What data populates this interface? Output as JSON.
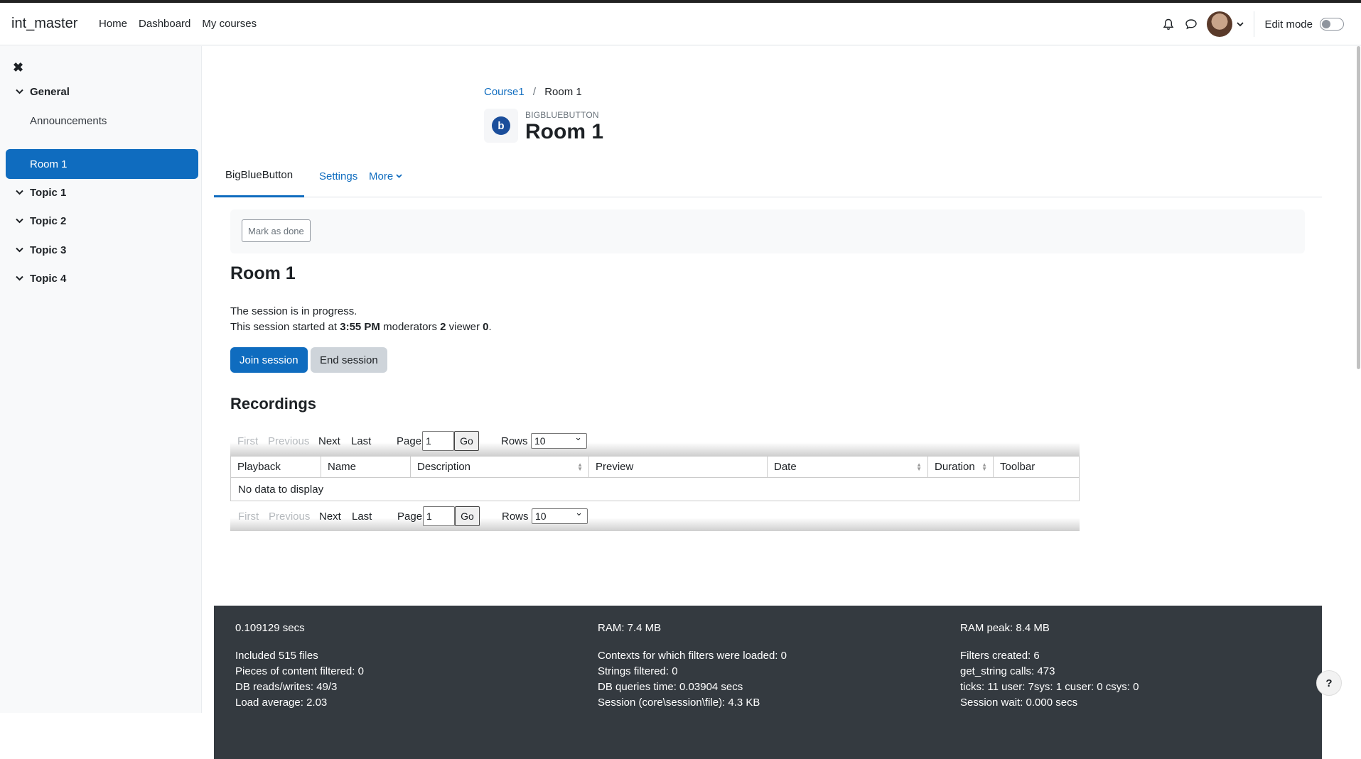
{
  "navbar": {
    "brand": "int_master",
    "links": [
      "Home",
      "Dashboard",
      "My courses"
    ],
    "edit_mode_label": "Edit mode"
  },
  "drawer": {
    "items": [
      {
        "label": "General",
        "type": "section"
      },
      {
        "label": "Announcements",
        "type": "link"
      },
      {
        "label": "Room 1",
        "type": "link",
        "active": true
      },
      {
        "label": "Topic 1",
        "type": "section"
      },
      {
        "label": "Topic 2",
        "type": "section"
      },
      {
        "label": "Topic 3",
        "type": "section"
      },
      {
        "label": "Topic 4",
        "type": "section"
      }
    ]
  },
  "breadcrumb": {
    "course": "Course1",
    "sep": "/",
    "current": "Room 1"
  },
  "activity": {
    "type": "BIGBLUEBUTTON",
    "title": "Room 1",
    "icon_letter": "b"
  },
  "tabs": [
    "BigBlueButton",
    "Settings",
    "More"
  ],
  "completion": {
    "button": "Mark as done"
  },
  "room": {
    "heading": "Room 1",
    "status_line": "The session is in progress.",
    "started_prefix": "This session started at ",
    "started_time": "3:55 PM",
    "moderators_text": " moderators ",
    "moderators_count": "2",
    "viewer_text": " viewer ",
    "viewer_count": "0",
    "end_punct": ".",
    "join_button": "Join session",
    "end_button": "End session"
  },
  "recordings": {
    "heading": "Recordings",
    "pager": {
      "first": "First",
      "previous": "Previous",
      "next": "Next",
      "last": "Last",
      "page_label": "Page",
      "page_value": "1",
      "go": "Go",
      "rows_label": "Rows",
      "rows_value": "10"
    },
    "columns": [
      "Playback",
      "Name",
      "Description",
      "Preview",
      "Date",
      "Duration",
      "Toolbar"
    ],
    "empty": "No data to display"
  },
  "footer": {
    "col1": [
      "0.109129 secs",
      "Included 515 files",
      "Pieces of content filtered: 0",
      "DB reads/writes: 49/3",
      "Load average: 2.03"
    ],
    "col2": [
      "RAM: 7.4 MB",
      "Contexts for which filters were loaded: 0",
      "Strings filtered: 0",
      "DB queries time: 0.03904 secs",
      "Session (core\\session\\file): 4.3 KB"
    ],
    "col3": [
      "RAM peak: 8.4 MB",
      "Filters created: 6",
      "get_string calls: 473",
      "ticks: 11 user: 7sys: 1 cuser: 0 csys: 0",
      "Session wait: 0.000 secs"
    ]
  },
  "help_label": "?"
}
